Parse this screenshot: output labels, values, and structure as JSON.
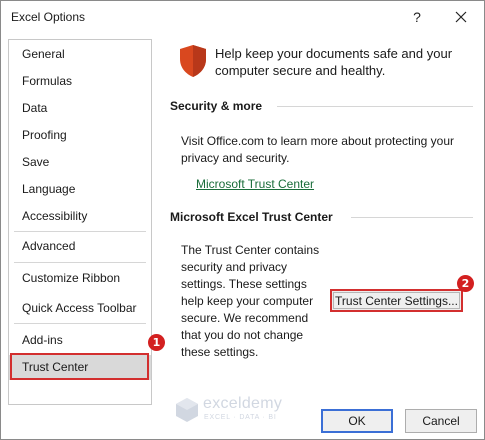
{
  "window": {
    "title": "Excel Options",
    "help_label": "?"
  },
  "sidebar": {
    "items": [
      {
        "label": "General"
      },
      {
        "label": "Formulas"
      },
      {
        "label": "Data"
      },
      {
        "label": "Proofing"
      },
      {
        "label": "Save"
      },
      {
        "label": "Language"
      },
      {
        "label": "Accessibility"
      },
      {
        "label": "Advanced"
      },
      {
        "label": "Customize Ribbon"
      },
      {
        "label": "Quick Access Toolbar"
      },
      {
        "label": "Add-ins"
      },
      {
        "label": "Trust Center",
        "selected": true
      }
    ]
  },
  "content": {
    "intro": "Help keep your documents safe and your computer secure and healthy.",
    "security_heading": "Security & more",
    "security_text": "Visit Office.com to learn more about protecting your privacy and security.",
    "trust_link": "Microsoft Trust Center",
    "trust_heading": "Microsoft Excel Trust Center",
    "trust_text": "The Trust Center contains security and privacy settings. These settings help keep your computer secure. We recommend that you do not change these settings.",
    "trust_settings_button": "Trust Center Settings..."
  },
  "footer": {
    "ok_label": "OK",
    "cancel_label": "Cancel"
  },
  "annotations": {
    "step1": "1",
    "step2": "2"
  },
  "watermark": {
    "name": "exceldemy",
    "tagline": "EXCEL · DATA · BI"
  },
  "colors": {
    "accent_red": "#d32f2f",
    "link_green": "#1a6d3a",
    "ok_border_blue": "#3b6fd6",
    "shield_orange": "#d9481f"
  }
}
